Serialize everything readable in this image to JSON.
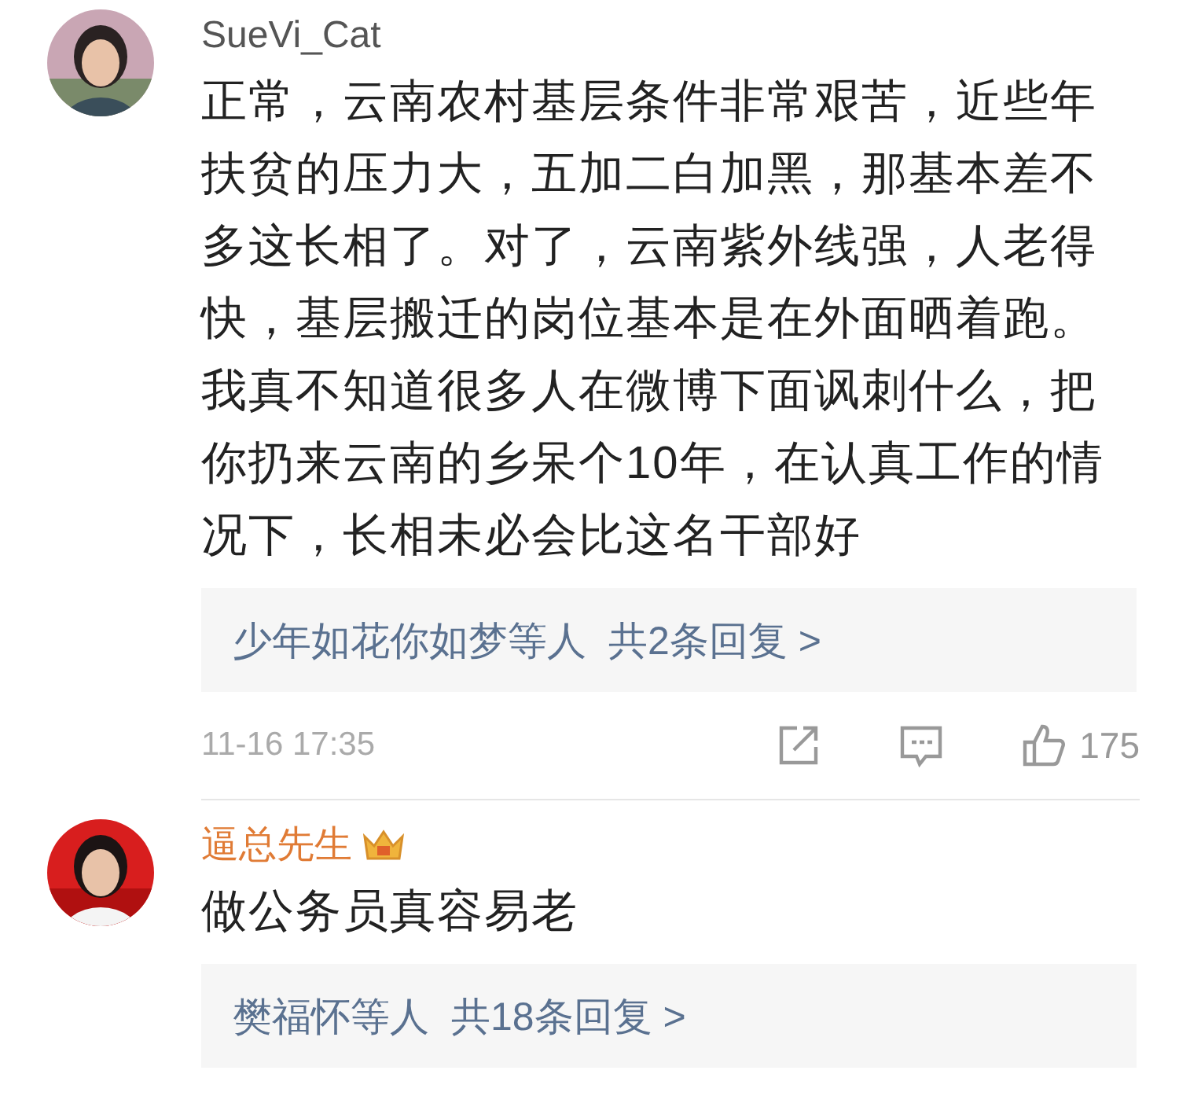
{
  "comments": [
    {
      "author": "SueVi_Cat",
      "vip": false,
      "text": "正常，云南农村基层条件非常艰苦，近些年扶贫的压力大，五加二白加黑，那基本差不多这长相了。对了，云南紫外线强，人老得快，基层搬迁的岗位基本是在外面晒着跑。我真不知道很多人在微博下面讽刺什么，把你扔来云南的乡呆个10年，在认真工作的情况下，长相未必会比这名干部好",
      "replies": {
        "people": "少年如花你如梦等人",
        "count": "共2条回复 >"
      },
      "time": "11-16 17:35",
      "likes": "175"
    },
    {
      "author": "逼总先生",
      "vip": true,
      "text": "做公务员真容易老",
      "replies": {
        "people": "樊福怀等人",
        "count": "共18条回复 >"
      }
    }
  ]
}
